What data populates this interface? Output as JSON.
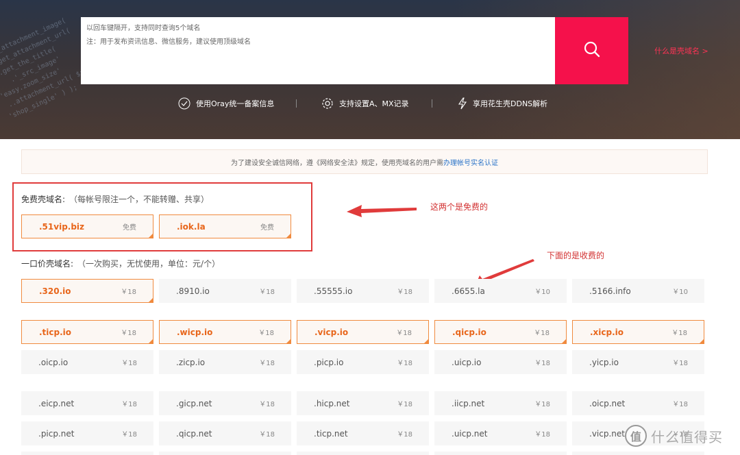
{
  "search": {
    "hint_line1": "以回车键隔开，支持同时查询5个域名",
    "hint_line2": "注：用于发布资讯信息、微信服务，建议使用顶级域名",
    "button_icon": "search-icon"
  },
  "what_link": "什么是壳域名 >",
  "features": [
    {
      "icon": "check-circle-icon",
      "label": "使用Oray统一备案信息"
    },
    {
      "icon": "gear-icon",
      "label": "支持设置A、MX记录"
    },
    {
      "icon": "lightning-icon",
      "label": "享用花生壳DDNS解析"
    }
  ],
  "notice": {
    "text": "为了建设安全诚信网络，遵《网络安全法》规定，使用壳域名的用户需",
    "link": "办理帐号实名认证"
  },
  "free_section": {
    "title": "免费壳域名:",
    "note": "（每帐号限注一个，不能转赠、共享）",
    "items": [
      {
        "name": ".51vip.biz",
        "price": "免费"
      },
      {
        "name": ".iok.la",
        "price": "免费"
      }
    ]
  },
  "paid_section": {
    "title": "一口价壳域名:",
    "note": "（一次购买，无忧使用，单位：元/个）",
    "rows": [
      [
        {
          "name": ".320.io",
          "price": "￥18",
          "hl": true
        },
        {
          "name": ".8910.io",
          "price": "￥18"
        },
        {
          "name": ".55555.io",
          "price": "￥18"
        },
        {
          "name": ".6655.la",
          "price": "￥10"
        },
        {
          "name": ".5166.info",
          "price": "￥10"
        }
      ],
      [
        {
          "name": ".ticp.io",
          "price": "￥18",
          "hl": true
        },
        {
          "name": ".wicp.io",
          "price": "￥18",
          "hl": true
        },
        {
          "name": ".vicp.io",
          "price": "￥18",
          "hl": true
        },
        {
          "name": ".qicp.io",
          "price": "￥18",
          "hl": true
        },
        {
          "name": ".xicp.io",
          "price": "￥18",
          "hl": true
        }
      ],
      [
        {
          "name": ".oicp.io",
          "price": "￥18"
        },
        {
          "name": ".zicp.io",
          "price": "￥18"
        },
        {
          "name": ".picp.io",
          "price": "￥18"
        },
        {
          "name": ".uicp.io",
          "price": "￥18"
        },
        {
          "name": ".yicp.io",
          "price": "￥18"
        }
      ],
      [
        {
          "name": ".eicp.net",
          "price": "￥18"
        },
        {
          "name": ".gicp.net",
          "price": "￥18"
        },
        {
          "name": ".hicp.net",
          "price": "￥18"
        },
        {
          "name": ".iicp.net",
          "price": "￥18"
        },
        {
          "name": ".oicp.net",
          "price": "￥18"
        }
      ],
      [
        {
          "name": ".picp.net",
          "price": "￥18"
        },
        {
          "name": ".qicp.net",
          "price": "￥18"
        },
        {
          "name": ".ticp.net",
          "price": "￥18"
        },
        {
          "name": ".uicp.net",
          "price": "￥18"
        },
        {
          "name": ".vicp.net",
          "price": "￥18"
        }
      ]
    ]
  },
  "annotations": {
    "free": "这两个是免费的",
    "paid": "下面的是收费的"
  },
  "watermark": {
    "logo": "值",
    "text": "什么值得买"
  },
  "colors": {
    "search_button": "#f5114b",
    "highlight_border": "#f08a3e",
    "highlight_text": "#e8661b",
    "annotation": "#d23030",
    "link": "#2a73c8"
  }
}
